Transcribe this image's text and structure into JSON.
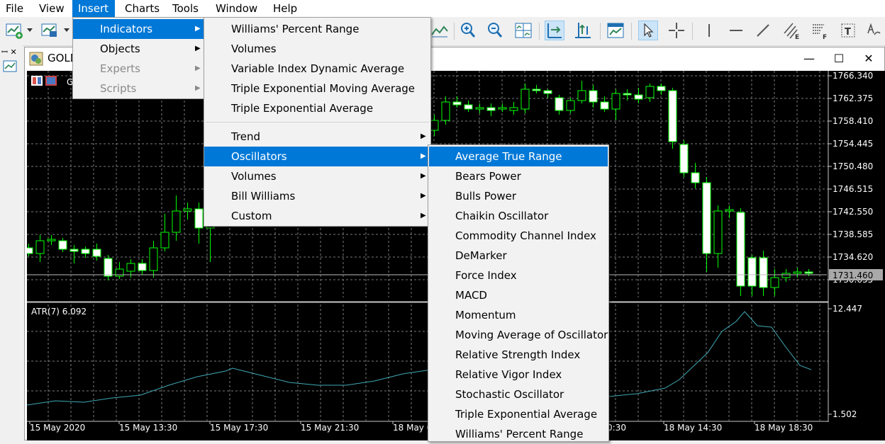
{
  "menubar": [
    "File",
    "View",
    "Insert",
    "Charts",
    "Tools",
    "Window",
    "Help"
  ],
  "window": {
    "title": "GOLD",
    "minimize": "—",
    "maximize": "☐",
    "close": "✕"
  },
  "chart": {
    "symbol_glyph": "G",
    "price_ticks": [
      "1766.340",
      "1762.375",
      "1758.410",
      "1754.445",
      "1750.480",
      "1746.515",
      "1742.550",
      "1738.585",
      "1734.620",
      "1730.655"
    ],
    "current_price": "1731.460",
    "atr_label": "ATR(7) 6.092",
    "atr_ticks": [
      "12.447",
      "1.502"
    ],
    "time_labels": [
      "15 May 2020",
      "15 May 13:30",
      "15 May 17:30",
      "15 May 21:30",
      "18 May 0",
      "0:30",
      "18 May 14:30",
      "18 May 18:30"
    ]
  },
  "insert_menu": [
    {
      "label": "Indicators",
      "arrow": "▶",
      "highlighted": true
    },
    {
      "label": "Objects",
      "arrow": "▶"
    },
    {
      "label": "Experts",
      "arrow": "▶",
      "disabled": true
    },
    {
      "label": "Scripts",
      "arrow": "▶",
      "disabled": true
    }
  ],
  "indicators_menu": {
    "recent": [
      "Williams' Percent Range",
      "Volumes",
      "Variable Index Dynamic Average",
      "Triple Exponential Moving Average",
      "Triple Exponential Average"
    ],
    "groups": [
      {
        "label": "Trend",
        "arrow": "▶"
      },
      {
        "label": "Oscillators",
        "arrow": "▶",
        "highlighted": true
      },
      {
        "label": "Volumes",
        "arrow": "▶"
      },
      {
        "label": "Bill Williams",
        "arrow": "▶"
      },
      {
        "label": "Custom",
        "arrow": "▶"
      }
    ]
  },
  "oscillators_menu": [
    "Average True Range",
    "Bears Power",
    "Bulls Power",
    "Chaikin Oscillator",
    "Commodity Channel Index",
    "DeMarker",
    "Force Index",
    "MACD",
    "Momentum",
    "Moving Average of Oscillator",
    "Relative Strength Index",
    "Relative Vigor Index",
    "Stochastic Oscillator",
    "Triple Exponential Average",
    "Williams' Percent Range"
  ],
  "colors": {
    "accent": "#0078d7",
    "bull": "#00ff00",
    "bear": "#ffffff",
    "grid": "#7a7a7a",
    "atr_line": "#3fa9b5",
    "price_line": "#c0c0c0"
  }
}
